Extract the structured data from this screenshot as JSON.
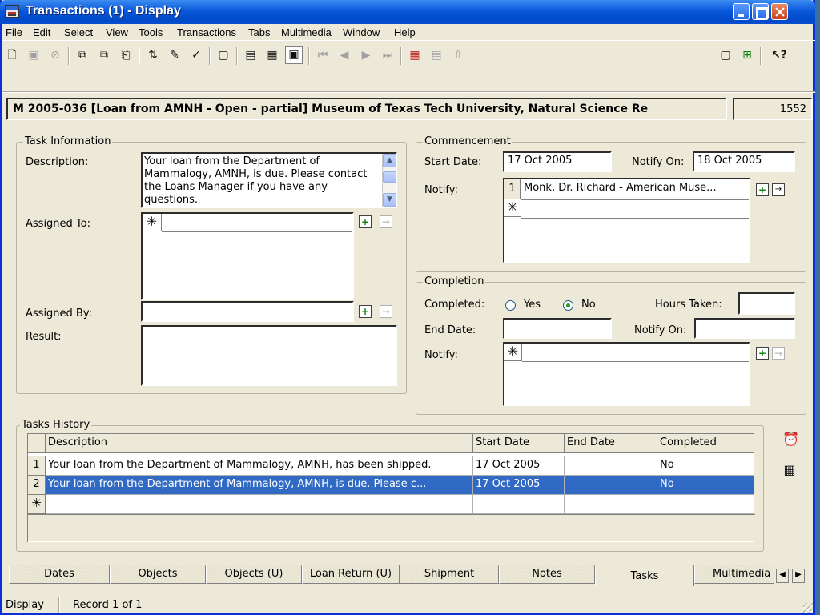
{
  "window": {
    "title": "Transactions (1) - Display"
  },
  "menu": [
    "File",
    "Edit",
    "Select",
    "View",
    "Tools",
    "Transactions",
    "Tabs",
    "Multimedia",
    "Window",
    "Help"
  ],
  "record": {
    "header": "M 2005-036 [Loan from AMNH - Open - partial] Museum of Texas Tech University, Natural Science Re",
    "number": "1552"
  },
  "task_info": {
    "title": "Task Information",
    "description_label": "Description:",
    "description_value": "Your loan from the Department of Mammalogy, AMNH, is due.  Please contact the Loans Manager if you have any questions.",
    "assigned_to_label": "Assigned To:",
    "assigned_by_label": "Assigned By:",
    "result_label": "Result:"
  },
  "commencement": {
    "title": "Commencement",
    "start_date_label": "Start Date:",
    "start_date": "17 Oct 2005",
    "notify_on_label": "Notify On:",
    "notify_on": "18 Oct 2005",
    "notify_label": "Notify:",
    "notify_rows": [
      {
        "num": "1",
        "name": "Monk, Dr. Richard - American Muse..."
      }
    ]
  },
  "completion": {
    "title": "Completion",
    "completed_label": "Completed:",
    "yes_label": "Yes",
    "no_label": "No",
    "completed_value": "No",
    "hours_label": "Hours Taken:",
    "end_date_label": "End Date:",
    "notify_on_label": "Notify On:",
    "notify_label": "Notify:"
  },
  "history": {
    "title": "Tasks History",
    "columns": [
      "Description",
      "Start Date",
      "End Date",
      "Completed"
    ],
    "rows": [
      {
        "num": "1",
        "description": "Your loan from the Department of Mammalogy, AMNH, has been shipped.",
        "start": "17 Oct 2005",
        "end": "",
        "completed": "No"
      },
      {
        "num": "2",
        "description": "Your loan from the Department of Mammalogy, AMNH, is due.  Please c...",
        "start": "17 Oct 2005",
        "end": "",
        "completed": "No"
      }
    ]
  },
  "tabs": [
    "Dates",
    "Objects",
    "Objects (U)",
    "Loan Return (U)",
    "Shipment",
    "Notes",
    "Tasks",
    "Multimedia"
  ],
  "active_tab": "Tasks",
  "status": {
    "mode": "Display",
    "record": "Record 1 of 1"
  },
  "colors": {
    "title_bar": "#0a58dc",
    "selection": "#316ac5",
    "window_bg": "#ece9d8"
  }
}
